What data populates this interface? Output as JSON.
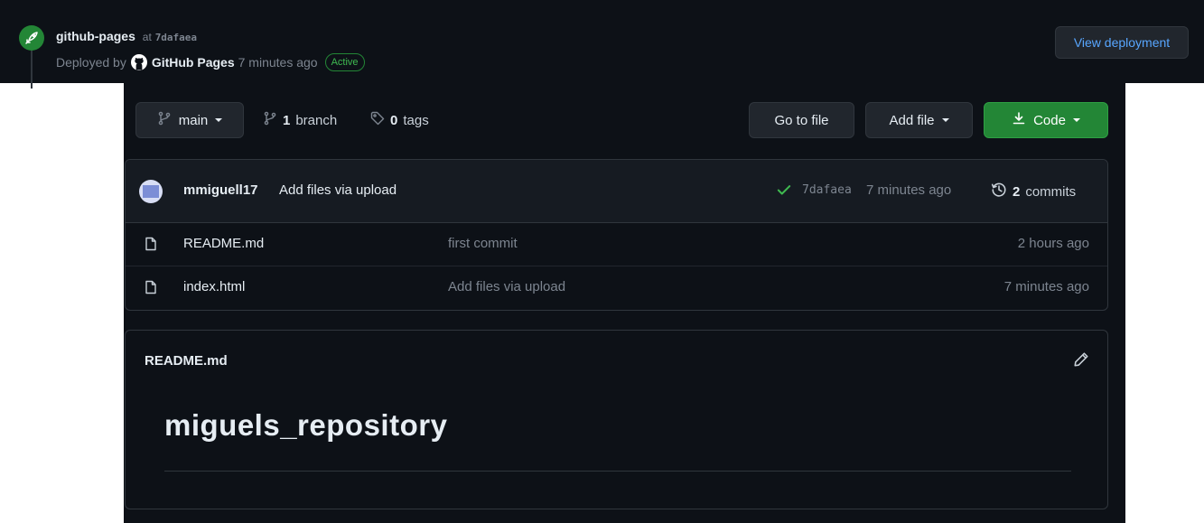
{
  "deployment": {
    "environment": "github-pages",
    "at_label": "at",
    "sha": "7dafaea",
    "deployed_by_label": "Deployed by",
    "deployer": "GitHub Pages",
    "time": "7 minutes ago",
    "status": "Active",
    "view_button": "View deployment",
    "icon": "rocket-icon"
  },
  "toolbar": {
    "branch": "main",
    "branch_count": "1",
    "branch_label": "branch",
    "tag_count": "0",
    "tag_label": "tags",
    "goto_file": "Go to file",
    "add_file": "Add file",
    "code": "Code"
  },
  "latest_commit": {
    "author": "mmiguell17",
    "message": "Add files via upload",
    "sha": "7dafaea",
    "time": "7 minutes ago",
    "commit_count": "2",
    "commit_label": "commits"
  },
  "files": [
    {
      "name": "README.md",
      "message": "first commit",
      "time": "2 hours ago"
    },
    {
      "name": "index.html",
      "message": "Add files via upload",
      "time": "7 minutes ago"
    }
  ],
  "readme": {
    "filename": "README.md",
    "heading": "miguels_repository"
  },
  "colors": {
    "background": "#0d1117",
    "accent_green": "#238636",
    "link_blue": "#58a6ff",
    "border": "#30363d"
  }
}
